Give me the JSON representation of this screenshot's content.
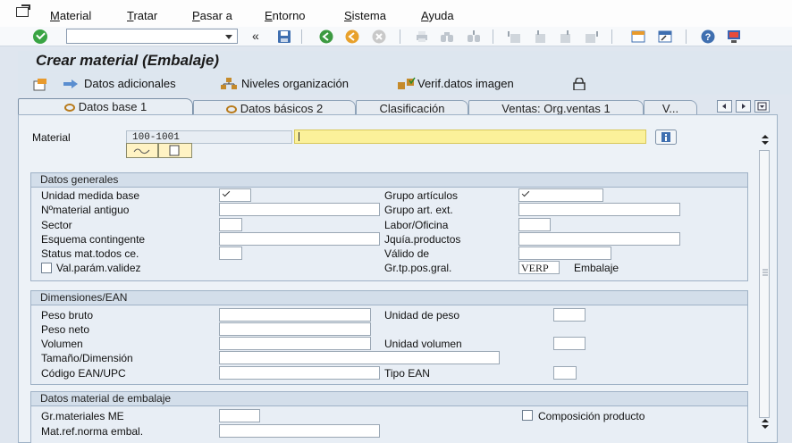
{
  "menubar": {
    "items": [
      "Material",
      "Tratar",
      "Pasar a",
      "Entorno",
      "Sistema",
      "Ayuda"
    ]
  },
  "toolbar": {
    "command_value": "",
    "nav_symbol": "«",
    "icons": [
      "check-icon",
      "save-icon",
      "back-icon",
      "exit-icon",
      "cancel-icon",
      "print-icon",
      "find-icon",
      "find-next-icon",
      "first-page-icon",
      "prev-page-icon",
      "next-page-icon",
      "last-page-icon",
      "new-session-icon",
      "shortcut-icon",
      "help-icon",
      "customize-icon"
    ]
  },
  "page": {
    "title": "Crear material (Embalaje)"
  },
  "app_toolbar": {
    "datos_adicionales": "Datos adicionales",
    "niveles_organizacion": "Niveles organización",
    "verif_datos_imagen": "Verif.datos imagen"
  },
  "tabs": [
    "Datos base 1",
    "Datos básicos 2",
    "Clasificación",
    "Ventas: Org.ventas 1",
    "V..."
  ],
  "header": {
    "material_label": "Material",
    "material_value": "100-1001",
    "description_value": ""
  },
  "groups": {
    "datos_generales": {
      "title": "Datos generales",
      "left": [
        "Unidad medida base",
        "Nºmaterial antiguo",
        "Sector",
        "Esquema contingente",
        "Status mat.todos ce.",
        "Val.parám.validez"
      ],
      "right": [
        "Grupo artículos",
        "Grupo art. ext.",
        "Labor/Oficina",
        "Jquía.productos",
        "Válido de",
        "Gr.tp.pos.gral."
      ],
      "gr_tp_value": "VERP",
      "gr_tp_text": "Embalaje"
    },
    "dimensiones": {
      "title": "Dimensiones/EAN",
      "left": [
        "Peso bruto",
        "Peso neto",
        "Volumen",
        "Tamaño/Dimensión",
        "Código EAN/UPC"
      ],
      "right": [
        "Unidad de peso",
        "Unidad volumen",
        "Tipo EAN"
      ]
    },
    "embalaje": {
      "title": "Datos material de embalaje",
      "left": [
        "Gr.materiales ME",
        "Mat.ref.norma embal."
      ],
      "composicion": "Composición producto"
    }
  },
  "colors": {
    "background": "#dfe6ef",
    "panel": "#edf2f7",
    "required_field": "#fbf19a",
    "group_header": "#d3deea",
    "ok_green": "#39a443"
  }
}
